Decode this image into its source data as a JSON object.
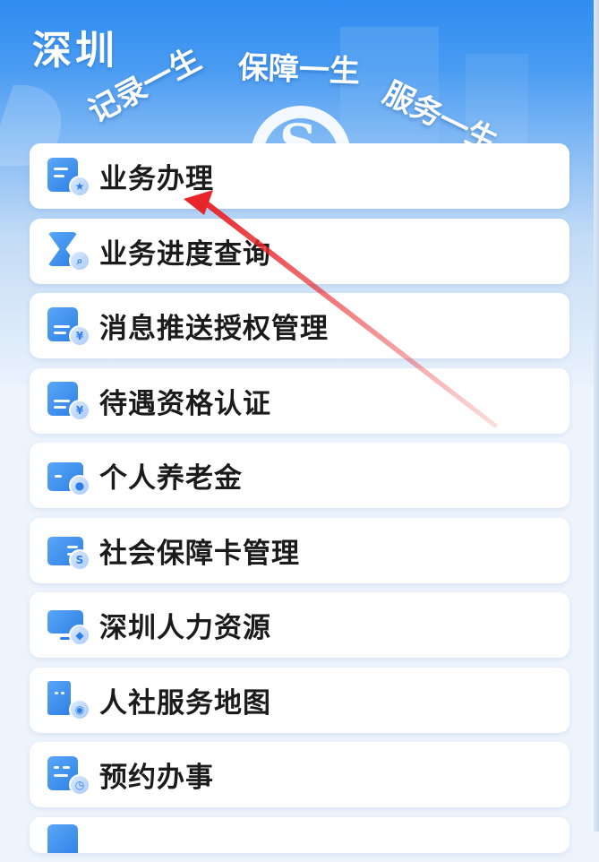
{
  "header": {
    "city": "深圳",
    "slogans": [
      "记录一生",
      "保障一生",
      "服务一生"
    ],
    "emblem_letter": "S"
  },
  "menu": {
    "items": [
      {
        "label": "业务办理",
        "icon": "service-handling-icon"
      },
      {
        "label": "业务进度查询",
        "icon": "hourglass-search-icon"
      },
      {
        "label": "消息推送授权管理",
        "icon": "message-authorization-icon"
      },
      {
        "label": "待遇资格认证",
        "icon": "qualification-certification-icon"
      },
      {
        "label": "个人养老金",
        "icon": "pension-card-icon"
      },
      {
        "label": "社会保障卡管理",
        "icon": "social-security-card-icon"
      },
      {
        "label": "深圳人力资源",
        "icon": "computer-monitor-icon"
      },
      {
        "label": "人社服务地图",
        "icon": "building-map-icon"
      },
      {
        "label": "预约办事",
        "icon": "appointment-calendar-icon"
      }
    ]
  },
  "annotation": {
    "color": "#e8262a",
    "points_to": "业务办理"
  }
}
